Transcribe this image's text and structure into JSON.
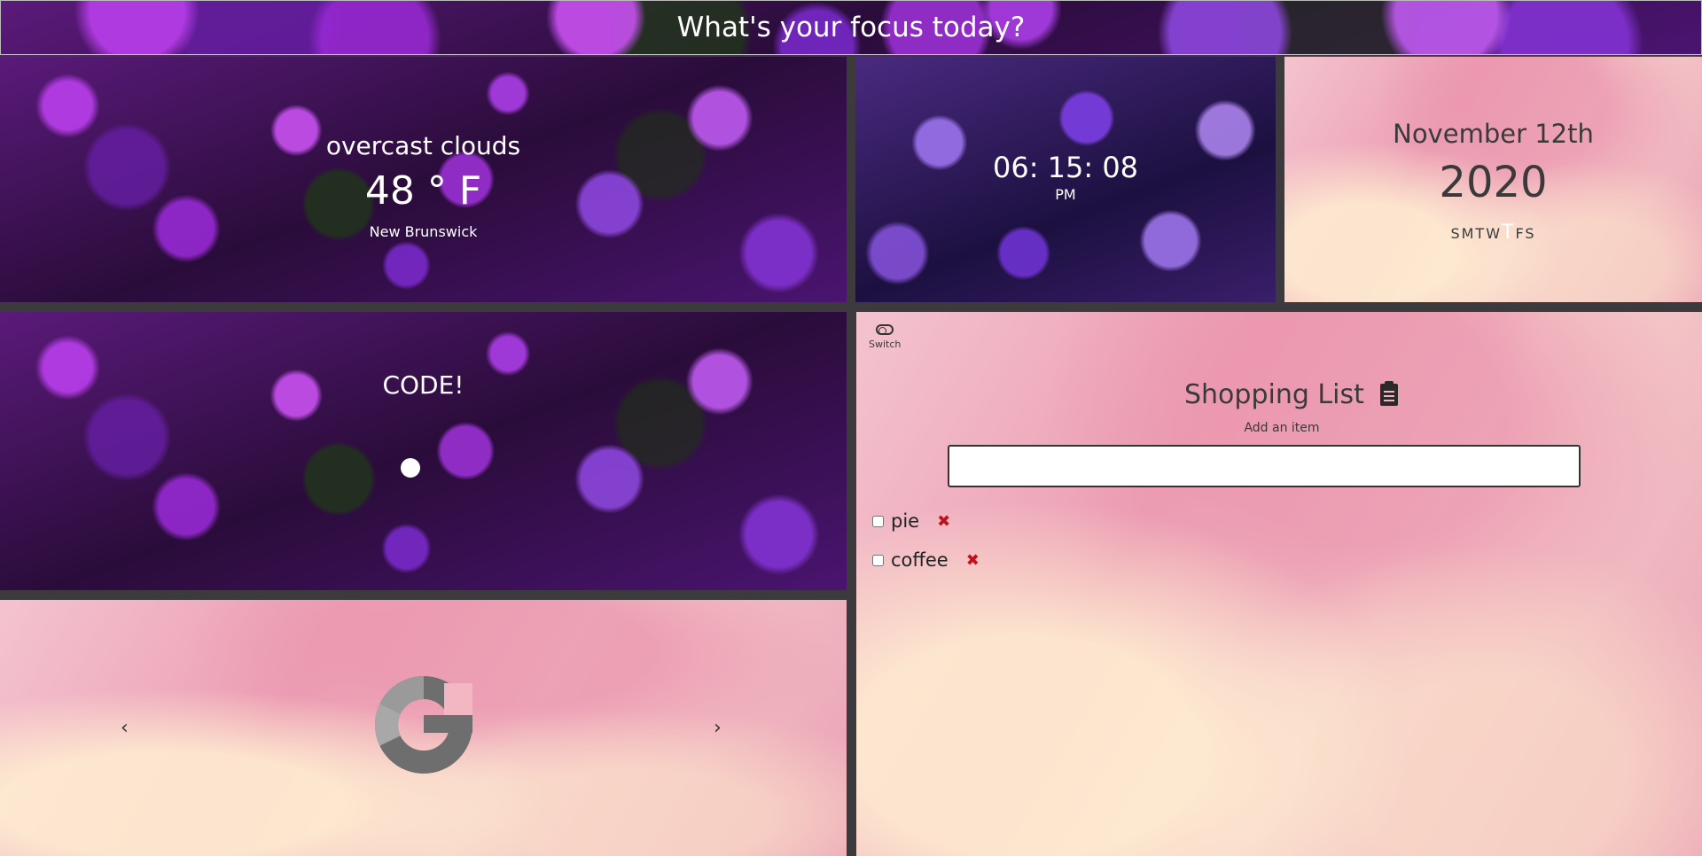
{
  "header": {
    "title": "What's your focus today?"
  },
  "weather": {
    "condition": "overcast clouds",
    "temperature": "48 ° F",
    "location": "New Brunswick"
  },
  "clock": {
    "time": "06: 15: 08",
    "ampm": "PM"
  },
  "date": {
    "month_day": "November 12th",
    "year": "2020",
    "weekdays": [
      "S",
      "M",
      "T",
      "W",
      "T",
      "F",
      "S"
    ],
    "today_index": 4
  },
  "focus": {
    "label": "CODE!"
  },
  "google": {
    "logo_icon": "google-g-logo",
    "prev_icon": "chevron-left-icon",
    "next_icon": "chevron-right-icon"
  },
  "shopping": {
    "switch_label": "Switch",
    "title": "Shopping List",
    "title_icon": "clipboard-icon",
    "subtitle": "Add an item",
    "input_value": "",
    "items": [
      {
        "label": "pie",
        "checked": false
      },
      {
        "label": "coffee",
        "checked": false
      }
    ],
    "remove_color": "#c0121b"
  },
  "colors": {
    "frame": "#3c3a3c",
    "dark_text": "#3a3a3a"
  }
}
